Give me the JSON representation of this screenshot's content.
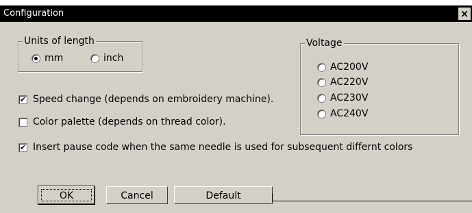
{
  "window": {
    "title": "Configuration",
    "close_glyph": "×"
  },
  "units_group": {
    "legend": "Units of length",
    "options": [
      {
        "label": "mm",
        "selected": true
      },
      {
        "label": "inch",
        "selected": false
      }
    ]
  },
  "voltage_group": {
    "legend": "Voltage",
    "options": [
      {
        "label": "AC200V",
        "selected": false
      },
      {
        "label": "AC220V",
        "selected": false
      },
      {
        "label": "AC230V",
        "selected": false
      },
      {
        "label": "AC240V",
        "selected": false
      }
    ]
  },
  "checkboxes": [
    {
      "label": "Speed change (depends on embroidery machine).",
      "checked": true
    },
    {
      "label": "Color palette (depends on thread color).",
      "checked": false
    },
    {
      "label": "Insert pause code when the same needle is used for subsequent differnt colors",
      "checked": true
    }
  ],
  "buttons": {
    "ok": "OK",
    "cancel": "Cancel",
    "default": "Default"
  },
  "check_glyph": "✔"
}
